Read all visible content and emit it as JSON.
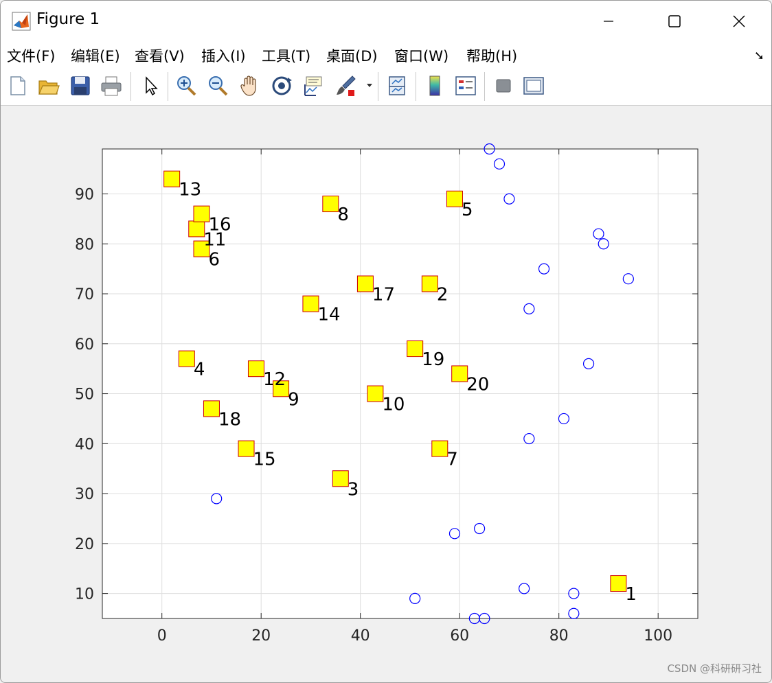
{
  "window": {
    "title": "Figure 1"
  },
  "menu": [
    "文件(F)",
    "编辑(E)",
    "查看(V)",
    "插入(I)",
    "工具(T)",
    "桌面(D)",
    "窗口(W)",
    "帮助(H)"
  ],
  "toolbar": [
    "new-figure-icon",
    "open-file-icon",
    "save-icon",
    "print-icon",
    "select-arrow-icon",
    "zoom-in-icon",
    "zoom-out-icon",
    "pan-hand-icon",
    "rotate-3d-icon",
    "data-cursor-icon",
    "brush-icon",
    "link-plot-icon",
    "colorbar-icon",
    "legend-icon",
    "hide-plot-tools-icon",
    "show-plot-tools-icon"
  ],
  "colors": {
    "square_fill": "#ffff00",
    "square_edge": "#cc0000",
    "circle_edge": "#0000ff"
  },
  "chart_data": {
    "type": "scatter",
    "xlim": [
      -12,
      108
    ],
    "ylim": [
      5,
      99
    ],
    "xticks": [
      0,
      20,
      40,
      60,
      80,
      100
    ],
    "yticks": [
      10,
      20,
      30,
      40,
      50,
      60,
      70,
      80,
      90
    ],
    "grid": true,
    "series": [
      {
        "marker": "square",
        "points": [
          {
            "x": 92,
            "y": 12,
            "label": "1"
          },
          {
            "x": 54,
            "y": 72,
            "label": "2"
          },
          {
            "x": 36,
            "y": 33,
            "label": "3"
          },
          {
            "x": 5,
            "y": 57,
            "label": "4"
          },
          {
            "x": 59,
            "y": 89,
            "label": "5"
          },
          {
            "x": 8,
            "y": 79,
            "label": "6"
          },
          {
            "x": 56,
            "y": 39,
            "label": "7"
          },
          {
            "x": 34,
            "y": 88,
            "label": "8"
          },
          {
            "x": 24,
            "y": 51,
            "label": "9"
          },
          {
            "x": 43,
            "y": 50,
            "label": "10"
          },
          {
            "x": 7,
            "y": 83,
            "label": "11"
          },
          {
            "x": 19,
            "y": 55,
            "label": "12"
          },
          {
            "x": 2,
            "y": 93,
            "label": "13"
          },
          {
            "x": 30,
            "y": 68,
            "label": "14"
          },
          {
            "x": 17,
            "y": 39,
            "label": "15"
          },
          {
            "x": 8,
            "y": 86,
            "label": "16"
          },
          {
            "x": 41,
            "y": 72,
            "label": "17"
          },
          {
            "x": 10,
            "y": 47,
            "label": "18"
          },
          {
            "x": 51,
            "y": 59,
            "label": "19"
          },
          {
            "x": 60,
            "y": 54,
            "label": "20"
          }
        ]
      },
      {
        "marker": "circle",
        "points": [
          {
            "x": 66,
            "y": 99
          },
          {
            "x": 68,
            "y": 96
          },
          {
            "x": 70,
            "y": 89
          },
          {
            "x": 88,
            "y": 82
          },
          {
            "x": 89,
            "y": 80
          },
          {
            "x": 77,
            "y": 75
          },
          {
            "x": 94,
            "y": 73
          },
          {
            "x": 74,
            "y": 67
          },
          {
            "x": 86,
            "y": 56
          },
          {
            "x": 81,
            "y": 45
          },
          {
            "x": 74,
            "y": 41
          },
          {
            "x": 11,
            "y": 29
          },
          {
            "x": 64,
            "y": 23
          },
          {
            "x": 59,
            "y": 22
          },
          {
            "x": 73,
            "y": 11
          },
          {
            "x": 83,
            "y": 10
          },
          {
            "x": 51,
            "y": 9
          },
          {
            "x": 83,
            "y": 6
          },
          {
            "x": 63,
            "y": 5
          },
          {
            "x": 65,
            "y": 5
          }
        ]
      }
    ]
  },
  "watermark": "CSDN @科研研习社"
}
